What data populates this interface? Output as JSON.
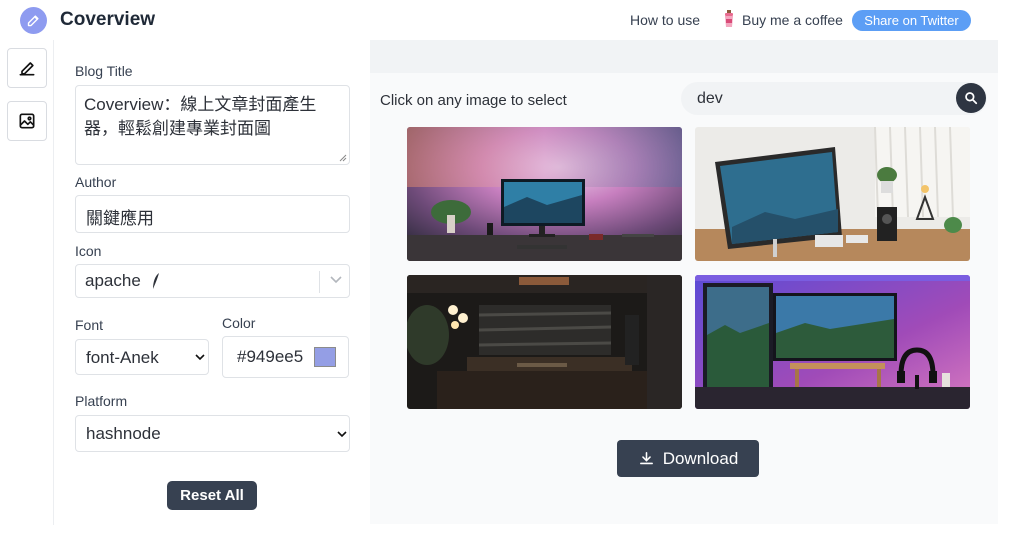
{
  "app": {
    "title": "Coverview"
  },
  "header": {
    "how_to_use": "How to use",
    "coffee": "Buy me a coffee",
    "share": "Share on Twitter"
  },
  "form": {
    "blog_title_label": "Blog Title",
    "blog_title_value": "Coverview：線上文章封面產生器，輕鬆創建專業封面圖",
    "author_label": "Author",
    "author_value": "關鍵應用",
    "icon_label": "Icon",
    "icon_value": "apache",
    "font_label": "Font",
    "font_value": "font-Anek",
    "color_label": "Color",
    "color_value": "#949ee5",
    "platform_label": "Platform",
    "platform_value": "hashnode",
    "reset_label": "Reset All"
  },
  "colors": {
    "accent": "#949ee5",
    "brand": "#8e9bf0",
    "twitter": "#5c9ef5",
    "dark_button": "#374151"
  },
  "gallery": {
    "hint": "Click on any image to select",
    "search_value": "dev",
    "images": [
      "desk-setup-colorful-lights",
      "white-desk-laptop-monitor",
      "dark-room-desk-lamp",
      "purple-lit-monitor-desk",
      "desk-photo-5",
      "desk-photo-6"
    ],
    "download_label": "Download"
  }
}
